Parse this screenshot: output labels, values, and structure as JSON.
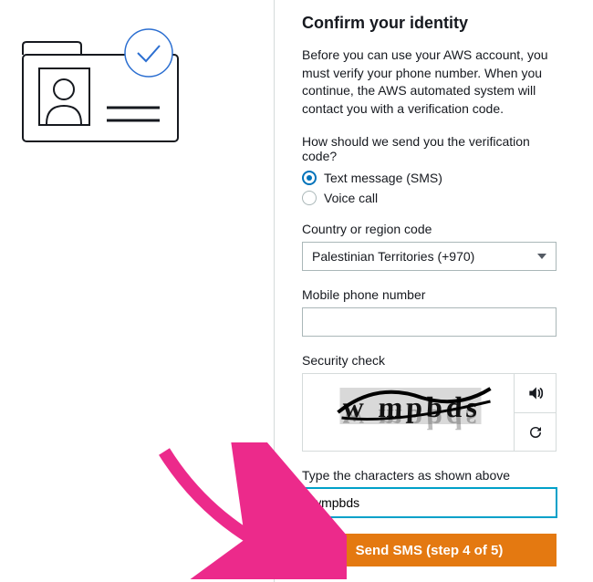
{
  "heading": "Confirm your identity",
  "description": "Before you can use your AWS account, you must verify your phone number. When you continue, the AWS automated system will contact you with a verification code.",
  "question": "How should we send you the verification code?",
  "radios": {
    "sms": "Text message (SMS)",
    "voice": "Voice call"
  },
  "country": {
    "label": "Country or region code",
    "value": "Palestinian Territories (+970)"
  },
  "phone": {
    "label": "Mobile phone number",
    "value": ""
  },
  "security": {
    "label": "Security check",
    "captcha_text": "wmpbds",
    "type_label": "Type the characters as shown above",
    "input_value": "wmpbds"
  },
  "submit_label": "Send SMS (step 4 of 5)"
}
